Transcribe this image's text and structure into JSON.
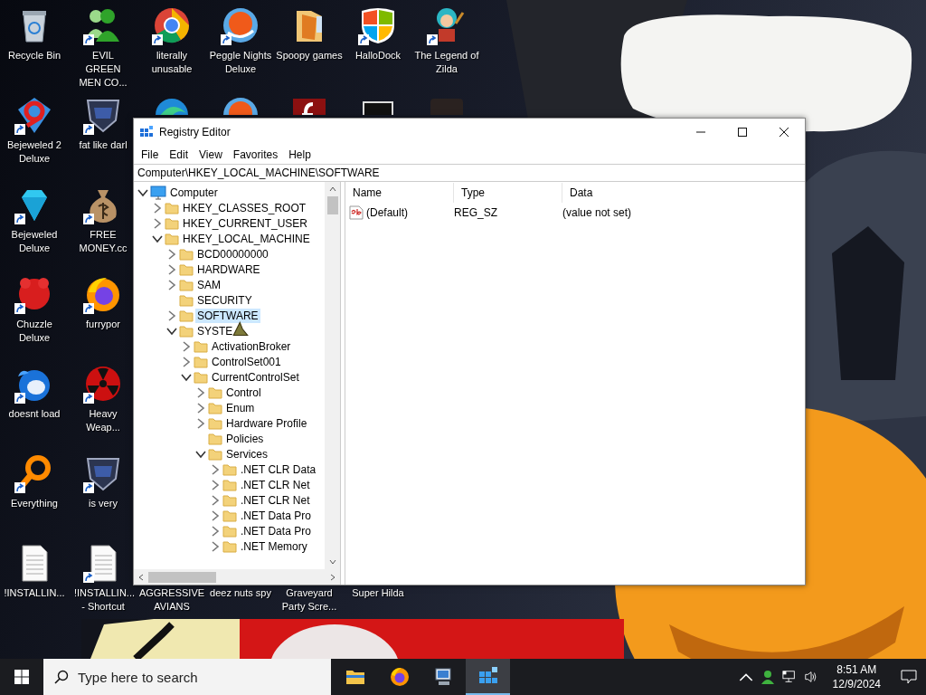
{
  "desktop": {
    "rows": [
      [
        {
          "label": "Recycle Bin",
          "kind": "bin",
          "shortcut": false
        },
        {
          "label": "EVIL GREEN MEN CO...",
          "kind": "people",
          "shortcut": true
        },
        {
          "label": "literally unusable",
          "kind": "browser",
          "shortcut": true
        },
        {
          "label": "Peggle Nights Deluxe",
          "kind": "ball",
          "shortcut": true
        },
        {
          "label": "Spoopy games",
          "kind": "folder",
          "shortcut": false
        },
        {
          "label": "HalloDock",
          "kind": "tiles",
          "shortcut": true
        },
        {
          "label": "The Legend of Zilda",
          "kind": "figure",
          "shortcut": true
        }
      ],
      [
        {
          "label": "Bejeweled 2 Deluxe",
          "kind": "ring",
          "shortcut": true
        },
        {
          "label": "fat like darl",
          "kind": "crest",
          "shortcut": true
        },
        {
          "kind": "swirl"
        },
        {
          "kind": "ball"
        },
        {
          "kind": "flash"
        },
        {
          "kind": "monitor"
        },
        {
          "kind": "dark"
        }
      ],
      [
        {
          "label": "Bejeweled Deluxe",
          "kind": "gem",
          "shortcut": true
        },
        {
          "label": "FREE MONEY.cc",
          "kind": "bag",
          "shortcut": true
        }
      ],
      [
        {
          "label": "Chuzzle Deluxe",
          "kind": "fuzz",
          "shortcut": true
        },
        {
          "label": "furrypor",
          "kind": "fox",
          "shortcut": true
        }
      ],
      [
        {
          "label": "doesnt load",
          "kind": "bird",
          "shortcut": true
        },
        {
          "label": "Heavy Weap...",
          "kind": "hazard",
          "shortcut": true
        }
      ],
      [
        {
          "label": "Everything",
          "kind": "loupe",
          "shortcut": true
        },
        {
          "label": "is very",
          "kind": "crest",
          "shortcut": true
        }
      ],
      [
        {
          "label": "!INSTALLIN...",
          "kind": "page",
          "shortcut": false
        },
        {
          "label": "!INSTALLIN... - Shortcut",
          "kind": "page",
          "shortcut": true
        },
        {
          "label": "AGGRESSIVE AVIANS"
        },
        {
          "label": "deez nuts spy"
        },
        {
          "label": "Graveyard Party Scre..."
        },
        {
          "label": "Super Hilda"
        }
      ]
    ]
  },
  "window": {
    "title": "Registry Editor",
    "menu": [
      "File",
      "Edit",
      "View",
      "Favorites",
      "Help"
    ],
    "address": "Computer\\HKEY_LOCAL_MACHINE\\SOFTWARE",
    "tree": [
      {
        "label": "Computer",
        "kind": "computer",
        "expanded": true,
        "selected": false,
        "children": [
          {
            "label": "HKEY_CLASSES_ROOT",
            "kind": "folder",
            "expanded": false,
            "selected": false
          },
          {
            "label": "HKEY_CURRENT_USER",
            "kind": "folder",
            "expanded": false,
            "selected": false
          },
          {
            "label": "HKEY_LOCAL_MACHINE",
            "kind": "folder",
            "expanded": true,
            "selected": false,
            "children": [
              {
                "label": "BCD00000000",
                "kind": "folder",
                "expanded": false,
                "selected": false
              },
              {
                "label": "HARDWARE",
                "kind": "folder",
                "expanded": false,
                "selected": false
              },
              {
                "label": "SAM",
                "kind": "folder",
                "expanded": false,
                "selected": false
              },
              {
                "label": "SECURITY",
                "kind": "leaf",
                "selected": false
              },
              {
                "label": "SOFTWARE",
                "kind": "folder",
                "expanded": false,
                "selected": true
              },
              {
                "label": "SYSTE",
                "kind": "folder",
                "expanded": true,
                "selected": false,
                "children": [
                  {
                    "label": "ActivationBroker",
                    "kind": "folder",
                    "expanded": false,
                    "selected": false
                  },
                  {
                    "label": "ControlSet001",
                    "kind": "folder",
                    "expanded": false,
                    "selected": false
                  },
                  {
                    "label": "CurrentControlSet",
                    "kind": "folder",
                    "expanded": true,
                    "selected": false,
                    "children": [
                      {
                        "label": "Control",
                        "kind": "folder",
                        "expanded": false,
                        "selected": false
                      },
                      {
                        "label": "Enum",
                        "kind": "folder",
                        "expanded": false,
                        "selected": false
                      },
                      {
                        "label": "Hardware Profile",
                        "kind": "folder",
                        "expanded": false,
                        "selected": false
                      },
                      {
                        "label": "Policies",
                        "kind": "leaf",
                        "selected": false
                      },
                      {
                        "label": "Services",
                        "kind": "folder",
                        "expanded": true,
                        "selected": false,
                        "children": [
                          {
                            "label": ".NET CLR Data",
                            "kind": "folder",
                            "expanded": false,
                            "selected": false
                          },
                          {
                            "label": ".NET CLR Net",
                            "kind": "folder",
                            "expanded": false,
                            "selected": false
                          },
                          {
                            "label": ".NET CLR Net",
                            "kind": "folder",
                            "expanded": false,
                            "selected": false
                          },
                          {
                            "label": ".NET Data Pro",
                            "kind": "folder",
                            "expanded": false,
                            "selected": false
                          },
                          {
                            "label": ".NET Data Pro",
                            "kind": "folder",
                            "expanded": false,
                            "selected": false
                          },
                          {
                            "label": ".NET Memory",
                            "kind": "folder",
                            "expanded": false,
                            "selected": false
                          }
                        ]
                      }
                    ]
                  }
                ]
              }
            ]
          }
        ]
      }
    ],
    "columns": [
      "Name",
      "Type",
      "Data"
    ],
    "values": [
      {
        "name": "(Default)",
        "type": "REG_SZ",
        "data": "(value not set)"
      }
    ]
  },
  "taskbar": {
    "search_placeholder": "Type here to search",
    "apps": [
      {
        "kind": "explorer",
        "active": false
      },
      {
        "kind": "fox",
        "active": false
      },
      {
        "kind": "pc",
        "active": false
      },
      {
        "kind": "regedit",
        "active": true
      }
    ],
    "time": "8:51 AM",
    "date": "12/9/2024"
  }
}
